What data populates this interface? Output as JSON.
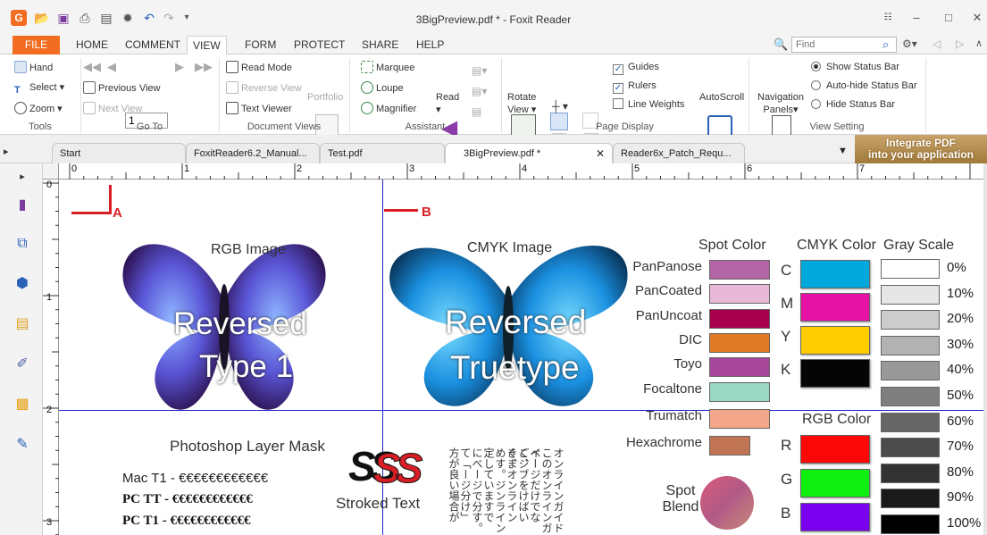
{
  "window": {
    "title": "3BigPreview.pdf * - Foxit Reader"
  },
  "menu": {
    "file": "FILE",
    "items": [
      "HOME",
      "COMMENT",
      "VIEW",
      "FORM",
      "PROTECT",
      "SHARE",
      "HELP"
    ],
    "active": "VIEW",
    "find_placeholder": "Find"
  },
  "ribbon": {
    "tools": {
      "hand": "Hand",
      "select": "Select",
      "zoom": "Zoom",
      "label": "Tools"
    },
    "goto": {
      "page_value": "1",
      "previous_view": "Previous View",
      "next_view": "Next View",
      "label": "Go To"
    },
    "document_views": {
      "read_mode": "Read Mode",
      "reverse_view": "Reverse View",
      "text_viewer": "Text Viewer",
      "portfolio": "Portfolio",
      "label": "Document Views"
    },
    "assistant": {
      "marquee": "Marquee",
      "loupe": "Loupe",
      "magnifier": "Magnifier",
      "read": "Read",
      "label": "Assistant"
    },
    "page_display": {
      "rotate_view_1": "Rotate",
      "rotate_view_2": "View",
      "guides": "Guides",
      "rulers": "Rulers",
      "line_weights": "Line Weights",
      "autoscroll": "AutoScroll",
      "label": "Page Display"
    },
    "view_setting": {
      "nav_panels_1": "Navigation",
      "nav_panels_2": "Panels",
      "show_status_bar": "Show Status Bar",
      "autohide_status_bar": "Auto-hide Status Bar",
      "hide_status_bar": "Hide Status Bar",
      "label": "View Setting"
    }
  },
  "tabs": [
    {
      "label": "Start"
    },
    {
      "label": "FoxitReader6.2_Manual..."
    },
    {
      "label": "Test.pdf"
    },
    {
      "label": "3BigPreview.pdf *"
    },
    {
      "label": "Reader6x_Patch_Requ..."
    }
  ],
  "banner": {
    "line1": "Integrate PDF",
    "line2": "into your application"
  },
  "ruler": {
    "h_numbers": [
      "0",
      "1",
      "2",
      "3",
      "4",
      "5",
      "6",
      "7"
    ],
    "v_numbers": [
      "0",
      "1",
      "2",
      "3"
    ]
  },
  "document": {
    "marker_a": "A",
    "marker_b": "B",
    "rgb_image": "RGB Image",
    "cmyk_image": "CMYK Image",
    "reversed_type1_l1": "Reversed",
    "reversed_type1_l2": "Type 1",
    "reversed_tt_l1": "Reversed",
    "reversed_tt_l2": "Truetype",
    "layer_mask": "Photoshop Layer Mask",
    "mac_t1": "Mac T1 - €€€€€€€€€€€€",
    "pc_tt": "PC TT - €€€€€€€€€€€€",
    "pc_t1": "PC T1 - €€€€€€€€€€€€",
    "stroked_text": "Stroked Text",
    "ss_glyph": "SS",
    "japanese_columns": [
      "オンラインガイド",
      "このオンラインガイ",
      "ページだけでなく、",
      "ごジブをけばいく、",
      "きまオンライン",
      "めす。ジンライン",
      "定していますで",
      "にべージで分す。",
      "て「ージ分け」",
      "方が良い場合が"
    ],
    "spot_color": {
      "title": "Spot Color",
      "items": [
        {
          "label": "PanPanose",
          "color": "#b266a6"
        },
        {
          "label": "PanCoated",
          "color": "#e8b8d8"
        },
        {
          "label": "PanUncoat",
          "color": "#a8004c"
        },
        {
          "label": "DIC",
          "color": "#e07a24"
        },
        {
          "label": "Toyo",
          "color": "#a8489a"
        },
        {
          "label": "Focaltone",
          "color": "#9ad8c4"
        },
        {
          "label": "Trumatch",
          "color": "#f4a68a"
        },
        {
          "label": "Hexachrome",
          "color": "#c07454"
        }
      ]
    },
    "spot_blend": {
      "line1": "Spot",
      "line2": "Blend"
    },
    "cmyk_color": {
      "title": "CMYK Color",
      "items": [
        {
          "label": "C",
          "color": "#00a8dc"
        },
        {
          "label": "M",
          "color": "#e612a6"
        },
        {
          "label": "Y",
          "color": "#ffcc00"
        },
        {
          "label": "K",
          "color": "#050505"
        }
      ]
    },
    "rgb_color": {
      "title": "RGB Color",
      "items": [
        {
          "label": "R",
          "color": "#fb0808"
        },
        {
          "label": "G",
          "color": "#10f010"
        },
        {
          "label": "B",
          "color": "#7a00f0"
        }
      ]
    },
    "gray_scale": {
      "title": "Gray Scale",
      "items": [
        {
          "label": "0%",
          "color": "#ffffff"
        },
        {
          "label": "10%",
          "color": "#e6e6e6"
        },
        {
          "label": "20%",
          "color": "#cccccc"
        },
        {
          "label": "30%",
          "color": "#b2b2b2"
        },
        {
          "label": "40%",
          "color": "#999999"
        },
        {
          "label": "50%",
          "color": "#7f7f7f"
        },
        {
          "label": "60%",
          "color": "#666666"
        },
        {
          "label": "70%",
          "color": "#4c4c4c"
        },
        {
          "label": "80%",
          "color": "#333333"
        },
        {
          "label": "90%",
          "color": "#1a1a1a"
        },
        {
          "label": "100%",
          "color": "#000000"
        }
      ]
    }
  }
}
